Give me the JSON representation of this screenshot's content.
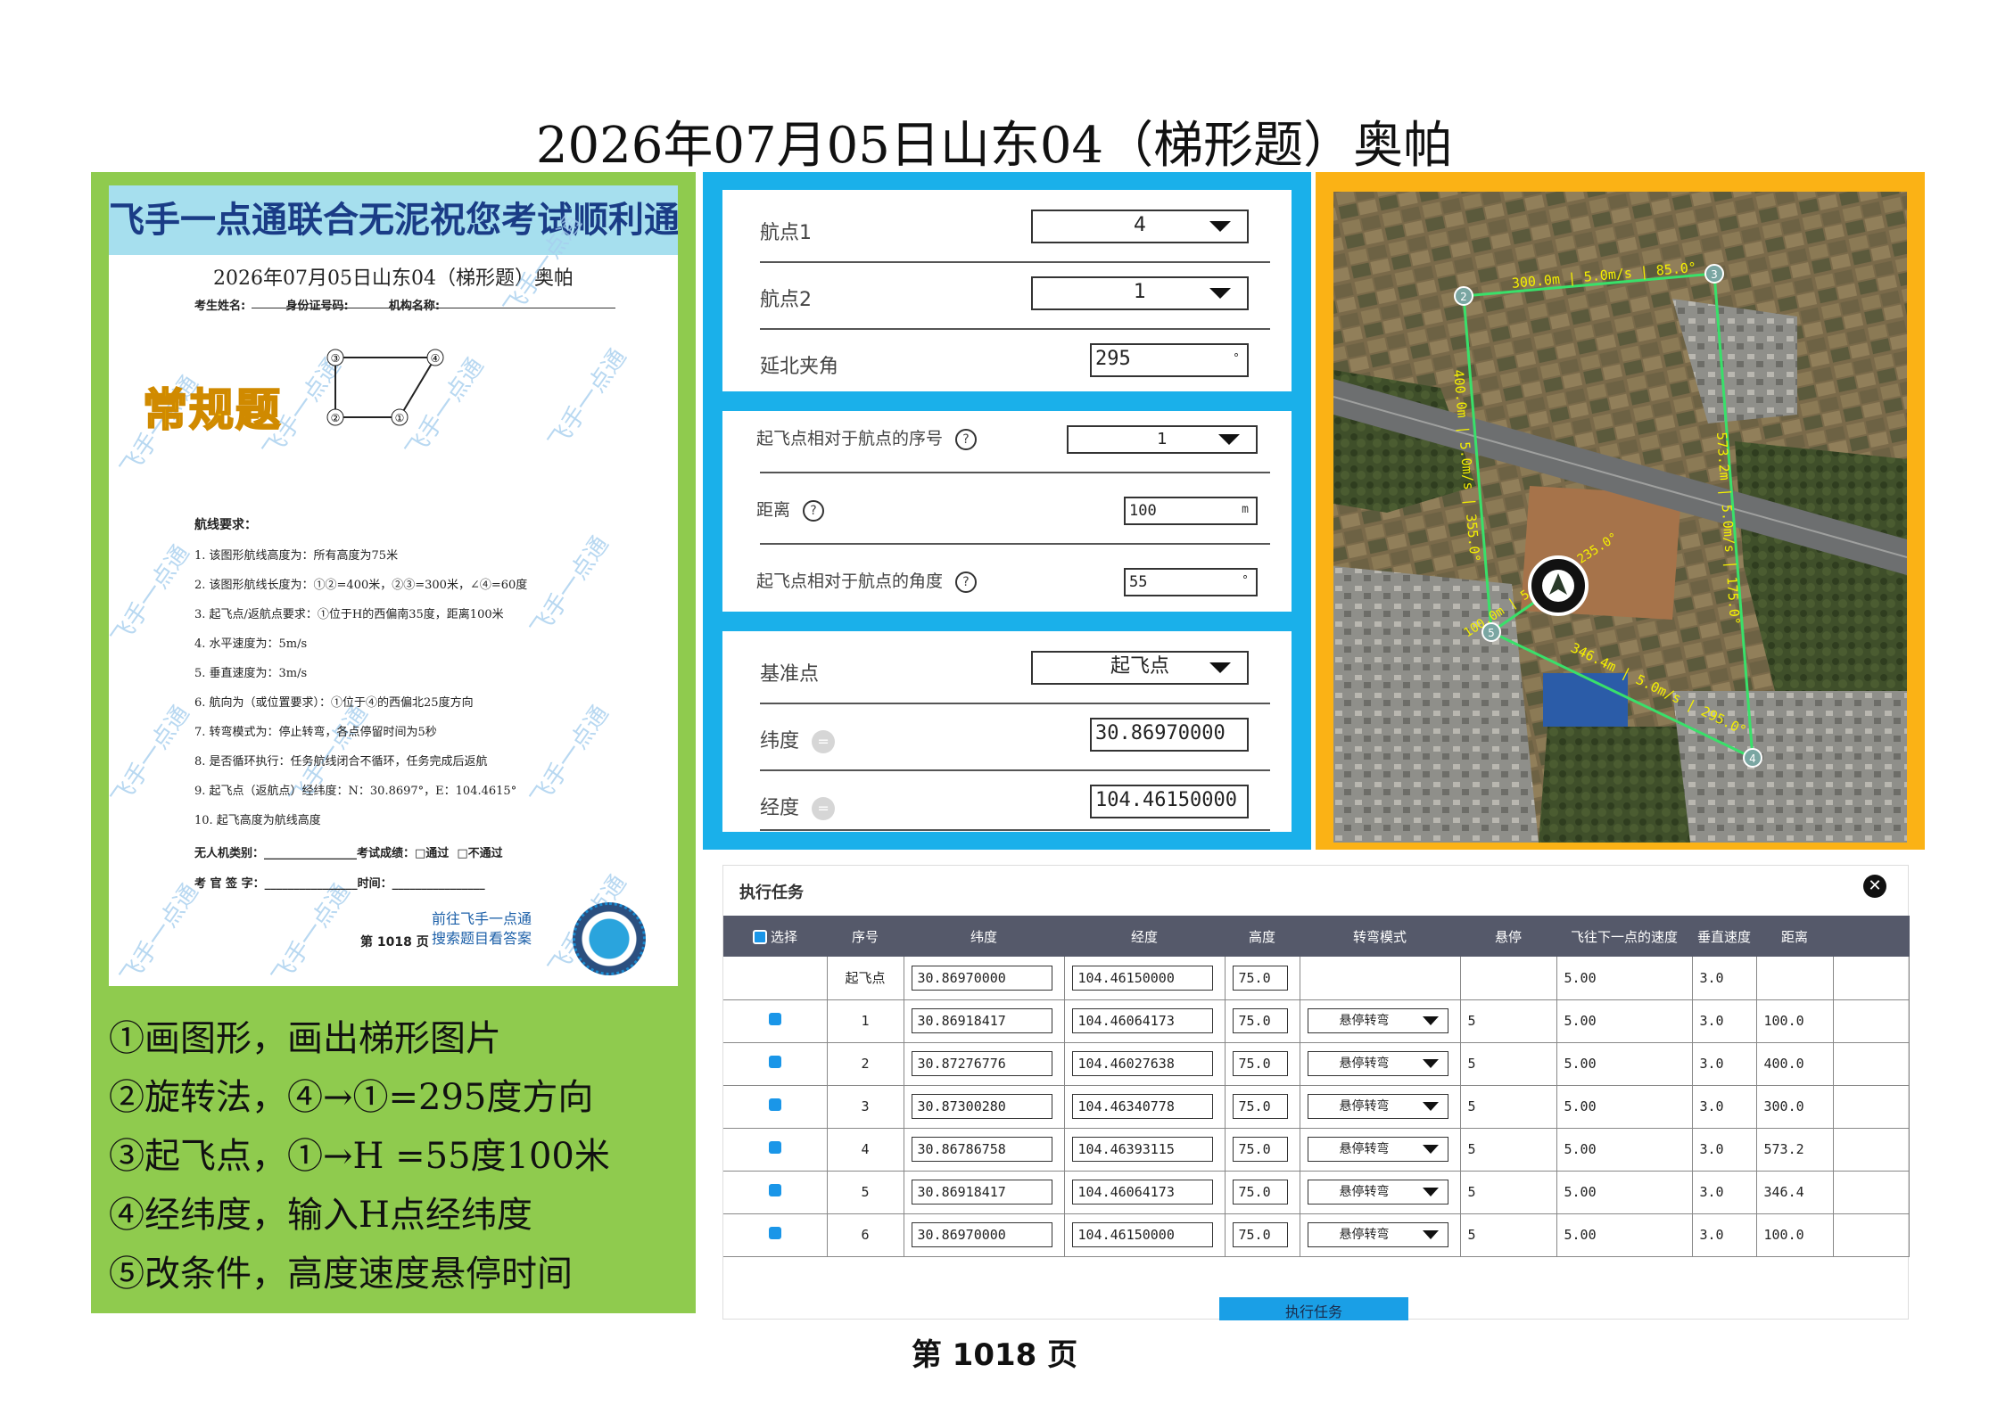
{
  "page_title": "2026年07月05日山东04（梯形题）奥帕",
  "sheet": {
    "banner": "飞手一点通联合无泥祝您考试顺利通过",
    "title": "2026年07月05日山东04（梯形题）奥帕",
    "info": "考生姓名:          身份证号码:          机构名称:",
    "badge": "常规题",
    "watermark": "飞手一点通",
    "diagram_labels": [
      "③",
      "④",
      "②",
      "①"
    ],
    "requirements_title": "航线要求：",
    "requirements": [
      "1.  该图形航线高度为：所有高度为75米",
      "2.  该图形航线长度为：①②=400米，②③=300米，∠④=60度",
      "3.  起飞点/返航点要求：①位于H的西偏南35度，距离100米",
      "4.  水平速度为：5m/s",
      "5.  垂直速度为：3m/s",
      "6.  航向为（或位置要求）：①位于④的西偏北25度方向",
      "7.  转弯模式为：停止转弯，各点停留时间为5秒",
      "8.  是否循环执行：任务航线闭合不循环，任务完成后返航",
      "9.  起飞点（返航点）经纬度：N：30.8697°，E：104.4615°",
      "10. 起飞高度为航线高度"
    ],
    "uav_line": "无人机类别：________________考试成绩：□通过  □不通过",
    "exam_line": "考 官 签 字：________________时间：________________",
    "goto_line1": "前往飞手一点通",
    "goto_line2": "搜索题目看答案",
    "page_number": "第 1018 页"
  },
  "steps": [
    "①画图形，画出梯形图片",
    "②旋转法，④→①=295度方向",
    "③起飞点，①→H =55度100米",
    "④经纬度，输入H点经纬度",
    "⑤改条件，高度速度悬停时间"
  ],
  "rotation_card": {
    "waypoint1_label": "航点1",
    "waypoint1_value": "4",
    "waypoint2_label": "航点2",
    "waypoint2_value": "1",
    "angle_label": "延北夹角",
    "angle_value": "295",
    "angle_unit": "°"
  },
  "takeoff_card": {
    "seq_label": "起飞点相对于航点的序号",
    "seq_value": "1",
    "distance_label": "距离",
    "distance_value": "100",
    "distance_unit": "m",
    "angle_label": "起飞点相对于航点的角度",
    "angle_value": "55",
    "angle_unit": "°",
    "help_icon": "?"
  },
  "reference_card": {
    "ref_label": "基准点",
    "ref_value": "起飞点",
    "lat_label": "纬度",
    "lat_value": "30.86970000",
    "lon_label": "经度",
    "lon_value": "104.46150000",
    "eq_icon": "="
  },
  "map": {
    "segment_labels": [
      "300.0m | 5.0m/s | 85.0°",
      "400.0m | 5.0m/s | 355.0°",
      "573.2m | 5.0m/s | 175.0°",
      "346.4m | 5.0m/s | 295.0°",
      "100.0m | 5.0m/s | 235.0°"
    ],
    "waypoint_labels": [
      "2",
      "3",
      "4",
      "5"
    ],
    "colors": {
      "route": "#39e06a",
      "label": "#f4f000"
    }
  },
  "task": {
    "title": "执行任务",
    "close": "✕",
    "headers": [
      "选择",
      "序号",
      "纬度",
      "经度",
      "高度",
      "转弯模式",
      "悬停",
      "飞往下一点的速度",
      "垂直速度",
      "距离"
    ],
    "takeoff_row": {
      "seq": "起飞点",
      "lat": "30.86970000",
      "lon": "104.46150000",
      "alt": "75.0",
      "speed": "5.00",
      "vspeed": "3.0"
    },
    "rows": [
      {
        "seq": "1",
        "lat": "30.86918417",
        "lon": "104.46064173",
        "alt": "75.0",
        "mode": "悬停转弯",
        "hover": "5",
        "speed": "5.00",
        "vspeed": "3.0",
        "dist": "100.0"
      },
      {
        "seq": "2",
        "lat": "30.87276776",
        "lon": "104.46027638",
        "alt": "75.0",
        "mode": "悬停转弯",
        "hover": "5",
        "speed": "5.00",
        "vspeed": "3.0",
        "dist": "400.0"
      },
      {
        "seq": "3",
        "lat": "30.87300280",
        "lon": "104.46340778",
        "alt": "75.0",
        "mode": "悬停转弯",
        "hover": "5",
        "speed": "5.00",
        "vspeed": "3.0",
        "dist": "300.0"
      },
      {
        "seq": "4",
        "lat": "30.86786758",
        "lon": "104.46393115",
        "alt": "75.0",
        "mode": "悬停转弯",
        "hover": "5",
        "speed": "5.00",
        "vspeed": "3.0",
        "dist": "573.2"
      },
      {
        "seq": "5",
        "lat": "30.86918417",
        "lon": "104.46064173",
        "alt": "75.0",
        "mode": "悬停转弯",
        "hover": "5",
        "speed": "5.00",
        "vspeed": "3.0",
        "dist": "346.4"
      },
      {
        "seq": "6",
        "lat": "30.86970000",
        "lon": "104.46150000",
        "alt": "75.0",
        "mode": "悬停转弯",
        "hover": "5",
        "speed": "5.00",
        "vspeed": "3.0",
        "dist": "100.0"
      }
    ],
    "execute_button": "执行任务"
  },
  "footer": "第 1018 页"
}
